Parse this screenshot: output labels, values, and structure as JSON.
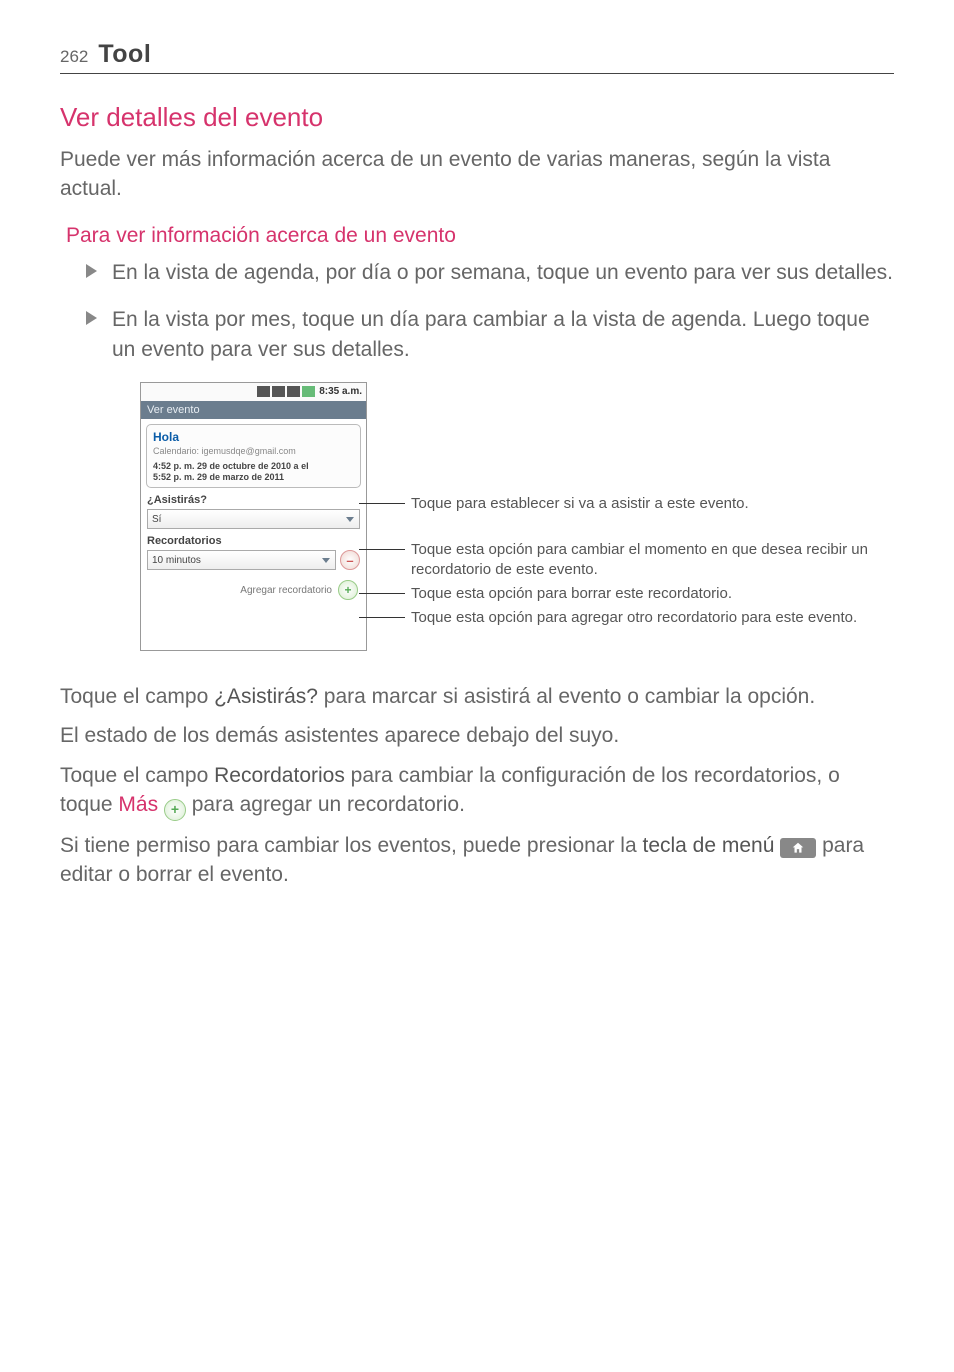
{
  "header": {
    "page_number": "262",
    "title": "Tool"
  },
  "section": {
    "heading": "Ver detalles del evento",
    "intro": "Puede ver más información acerca de un evento de varias maneras, según la vista actual.",
    "sub_heading": "Para ver información acerca de un evento",
    "bullets": [
      "En la vista de agenda, por día o por semana, toque un evento para ver sus detalles.",
      "En la vista por mes, toque un día para cambiar a la vista de agenda. Luego toque un evento para ver sus detalles."
    ]
  },
  "phone": {
    "status_time": "8:35 a.m.",
    "title_bar": "Ver evento",
    "event": {
      "title": "Hola",
      "calendar": "Calendario: igemusdqe@gmail.com",
      "time_line1": "4:52 p. m. 29 de octubre de 2010 a el",
      "time_line2": "5:52 p. m. 29 de marzo de 2011"
    },
    "attend_label": "¿Asistirás?",
    "attend_value": "Sí",
    "reminders_label": "Recordatorios",
    "reminder_value": "10 minutos",
    "add_reminder_label": "Agregar recordatorio"
  },
  "annotations": {
    "a1": "Toque para establecer si va a asistir a este evento.",
    "a2": "Toque esta opción para cambiar el momento en que desea recibir un recordatorio de este evento.",
    "a3": "Toque esta opción para borrar este recordatorio.",
    "a4": "Toque esta opción para agregar otro recordatorio para este evento."
  },
  "body": {
    "p1a": "Toque el campo ",
    "p1b": "¿Asistirás?",
    "p1c": " para marcar si asistirá al evento o cambiar la opción.",
    "p2": "El estado de los demás asistentes aparece debajo del suyo.",
    "p3a": "Toque el campo ",
    "p3b": "Recordatorios",
    "p3c": " para cambiar la configuración de los recordatorios, o toque ",
    "p3d": "Más",
    "p3e": " para agregar un recordatorio.",
    "p4a": "Si tiene permiso para cambiar los eventos, puede presionar la ",
    "p4b": "tecla de menú",
    "p4c": "  para editar o borrar el evento."
  }
}
